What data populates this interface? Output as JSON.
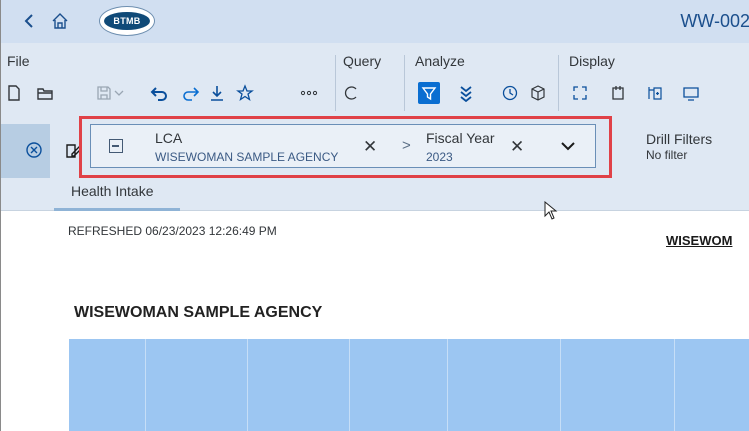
{
  "shell": {
    "logo_text": "BTMB",
    "document_title": "WW-002"
  },
  "toolbar": {
    "groups": {
      "file": "File",
      "query": "Query",
      "analyze": "Analyze",
      "display": "Display"
    },
    "icons": [
      "new-document-icon",
      "open-folder-icon",
      "save-icon",
      "save-dropdown-icon",
      "undo-icon",
      "redo-icon",
      "export-download-icon",
      "bookmark-star-icon",
      "more-icon",
      "refresh-query-icon",
      "filter-icon",
      "drill-icon",
      "history-icon",
      "data-objects-icon",
      "expand-icon",
      "insert-object-icon",
      "outline-icon",
      "monitor-icon"
    ],
    "accent": "#0a6ed1"
  },
  "filter_bar": {
    "chips": [
      {
        "name": "LCA",
        "value": "WISEWOMAN SAMPLE AGENCY"
      },
      {
        "name": "Fiscal Year",
        "value": "2023"
      }
    ],
    "drill_filters_label": "Drill Filters",
    "drill_filters_value": "No filter",
    "highlight_color": "#e04147"
  },
  "tabs": [
    {
      "label": "Health Intake",
      "active": true
    }
  ],
  "report": {
    "refreshed": "REFRESHED 06/23/2023 12:26:49 PM",
    "title_partial": "WISEWOM",
    "agency_heading": "WISEWOMAN SAMPLE AGENCY",
    "table_header_color": "#9cc6f2"
  }
}
